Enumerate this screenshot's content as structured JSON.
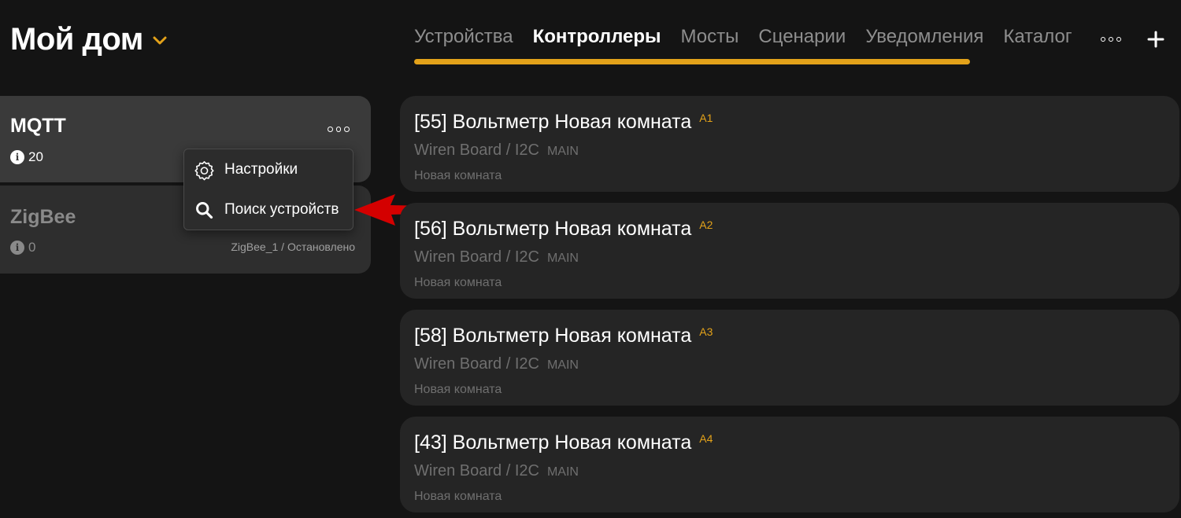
{
  "header": {
    "home_title": "Мой дом",
    "accent_color": "#e3a21a",
    "chevron_icon": "chevron-down-icon",
    "tabs": [
      {
        "label": "Устройства",
        "active": false
      },
      {
        "label": "Контроллеры",
        "active": true
      },
      {
        "label": "Мосты",
        "active": false
      },
      {
        "label": "Сценарии",
        "active": false
      },
      {
        "label": "Уведомления",
        "active": false
      },
      {
        "label": "Каталог",
        "active": false
      }
    ],
    "more_icon": "more-horizontal-icon",
    "add_icon": "plus-icon"
  },
  "controllers": [
    {
      "name": "MQTT",
      "count": "20",
      "status": "",
      "selected": true
    },
    {
      "name": "ZigBee",
      "count": "0",
      "status": "ZigBee_1 / Остановлено",
      "selected": false
    }
  ],
  "context_menu": {
    "items": [
      {
        "label": "Настройки",
        "icon": "gear-icon"
      },
      {
        "label": "Поиск устройств",
        "icon": "search-icon"
      }
    ]
  },
  "annotation": {
    "arrow_color": "#d40000"
  },
  "devices": [
    {
      "title": "[55] Вольтметр Новая комната",
      "badge": "A1",
      "type": "Wiren Board / I2C",
      "tag": "MAIN",
      "room": "Новая комната"
    },
    {
      "title": "[56] Вольтметр Новая комната",
      "badge": "A2",
      "type": "Wiren Board / I2C",
      "tag": "MAIN",
      "room": "Новая комната"
    },
    {
      "title": "[58] Вольтметр Новая комната",
      "badge": "A3",
      "type": "Wiren Board / I2C",
      "tag": "MAIN",
      "room": "Новая комната"
    },
    {
      "title": "[43] Вольтметр Новая комната",
      "badge": "A4",
      "type": "Wiren Board / I2C",
      "tag": "MAIN",
      "room": "Новая комната"
    }
  ]
}
